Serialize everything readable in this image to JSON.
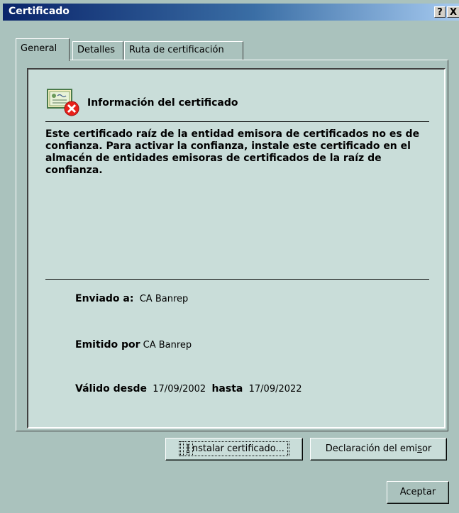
{
  "window": {
    "title": "Certificado",
    "help_glyph": "?",
    "close_glyph": "X"
  },
  "tabs": [
    {
      "label": "General",
      "active": true
    },
    {
      "label": "Detalles",
      "active": false
    },
    {
      "label": "Ruta de certificación",
      "active": false
    }
  ],
  "general": {
    "heading": "Información del certificado",
    "icon": "certificate-error-icon",
    "description": "Este certificado raíz de la entidad emisora de certificados no es de confianza. Para activar la confianza, instale este certificado en el almacén de entidades emisoras de certificados de la raíz de confianza.",
    "issued_to_label": "Enviado a:",
    "issued_to_value": "CA Banrep",
    "issued_by_label": "Emitido por",
    "issued_by_value": "CA Banrep",
    "valid_from_label": "Válido desde",
    "valid_from_value": "17/09/2002",
    "valid_to_label": "hasta",
    "valid_to_value": "17/09/2022"
  },
  "buttons": {
    "install_prefix": "",
    "install_mnemonic": "I",
    "install_rest": "nstalar certificado...",
    "issuer_prefix": "Declaración del emi",
    "issuer_mnemonic": "s",
    "issuer_rest": "or",
    "accept": "Aceptar"
  },
  "colors": {
    "face": "#aac2bd",
    "panel": "#c9ddd9",
    "titlebar": "#0a246a",
    "error": "#e8211a"
  }
}
